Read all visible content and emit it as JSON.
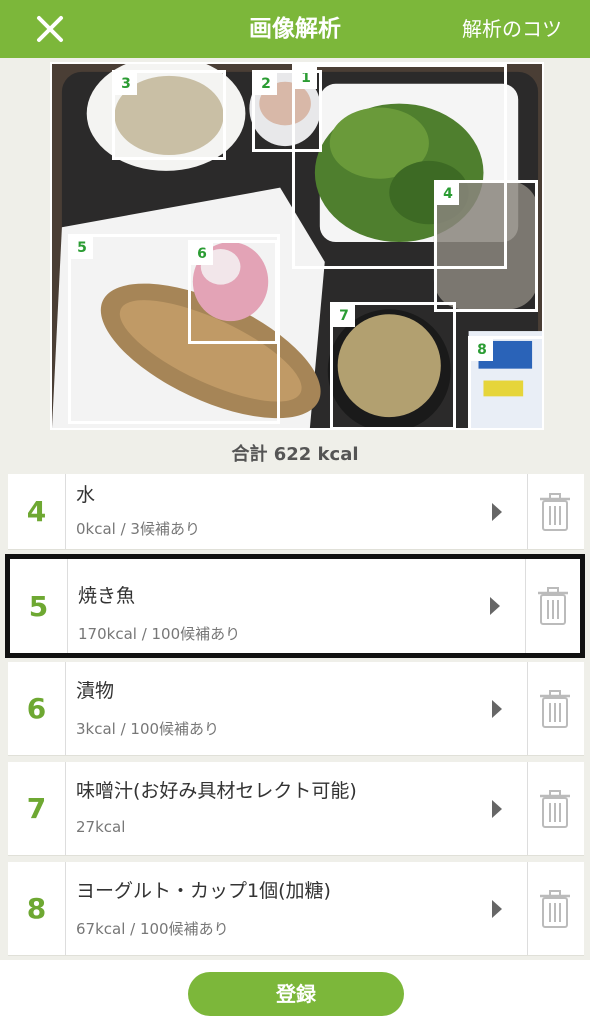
{
  "header": {
    "title": "画像解析",
    "tips_label": "解析のコツ"
  },
  "photo": {
    "boxes": [
      {
        "label": "1"
      },
      {
        "label": "2"
      },
      {
        "label": "3"
      },
      {
        "label": "4"
      },
      {
        "label": "5"
      },
      {
        "label": "6"
      },
      {
        "label": "7"
      },
      {
        "label": "8"
      }
    ]
  },
  "total_label": "合計 622 kcal",
  "items": [
    {
      "number": "4",
      "name": "水",
      "detail": "0kcal / 3候補あり"
    },
    {
      "number": "5",
      "name": "焼き魚",
      "detail": "170kcal / 100候補あり"
    },
    {
      "number": "6",
      "name": "漬物",
      "detail": "3kcal / 100候補あり"
    },
    {
      "number": "7",
      "name": "味噌汁(お好み具材セレクト可能)",
      "detail": "27kcal"
    },
    {
      "number": "8",
      "name": "ヨーグルト・カップ1個(加糖)",
      "detail": "67kcal / 100候補あり"
    }
  ],
  "footer": {
    "register_label": "登録"
  }
}
